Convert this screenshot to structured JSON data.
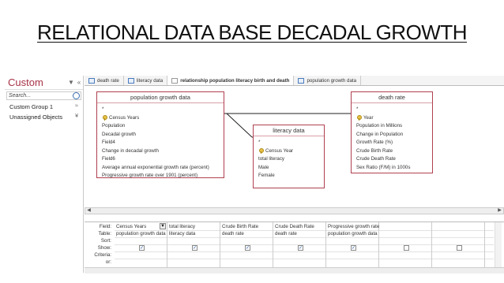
{
  "slide_title": "RELATIONAL DATA BASE DECADAL GROWTH",
  "nav": {
    "title": "Custom",
    "search_placeholder": "Search...",
    "items": [
      {
        "label": "Custom Group 1",
        "chevron": "≈"
      },
      {
        "label": "Unassigned Objects",
        "chevron": "¥"
      }
    ]
  },
  "tabs": [
    {
      "label": "death rate",
      "icon": "table-icon"
    },
    {
      "label": "literacy data",
      "icon": "table-icon"
    },
    {
      "label": "relationship population literacy birth and death",
      "icon": "relationship-icon",
      "active": true
    },
    {
      "label": "population growth data",
      "icon": "table-icon"
    }
  ],
  "tables": {
    "population": {
      "title": "population growth data",
      "fields": [
        "*",
        "Census Years",
        "Population",
        "Decadal growth",
        "Field4",
        "Change in decadal growth",
        "Field6",
        "Average annual exponential growth rate (percent)",
        "Progressive growth rate over 1901 (percent)"
      ]
    },
    "literacy": {
      "title": "literacy data",
      "fields": [
        "*",
        "Census Year",
        "total literacy",
        "Male",
        "Female"
      ]
    },
    "death": {
      "title": "death rate",
      "fields": [
        "*",
        "Year",
        "Population in Millions",
        "Change in Population",
        "Growth Rate (%)",
        "Crude Birth Rate",
        "Crude Death Rate",
        "Sex Ratio (F/M) in 1000s"
      ]
    }
  },
  "grid": {
    "row_labels": [
      "Field:",
      "Table:",
      "Sort:",
      "Show:",
      "Criteria:",
      "or:"
    ],
    "columns": [
      {
        "field": "Census Years",
        "table": "population growth data",
        "show": true
      },
      {
        "field": "total literacy",
        "table": "literacy data",
        "show": true
      },
      {
        "field": "Crude Birth Rate",
        "table": "death rate",
        "show": true
      },
      {
        "field": "Crude Death Rate",
        "table": "death rate",
        "show": true
      },
      {
        "field": "Progressive growth rate",
        "table": "population growth data",
        "show": true
      },
      {
        "field": "",
        "table": "",
        "show": false
      },
      {
        "field": "",
        "table": "",
        "show": false
      }
    ]
  },
  "colors": {
    "accent": "#a83246",
    "table_border": "#b04050",
    "link": "#2a5ea8"
  }
}
